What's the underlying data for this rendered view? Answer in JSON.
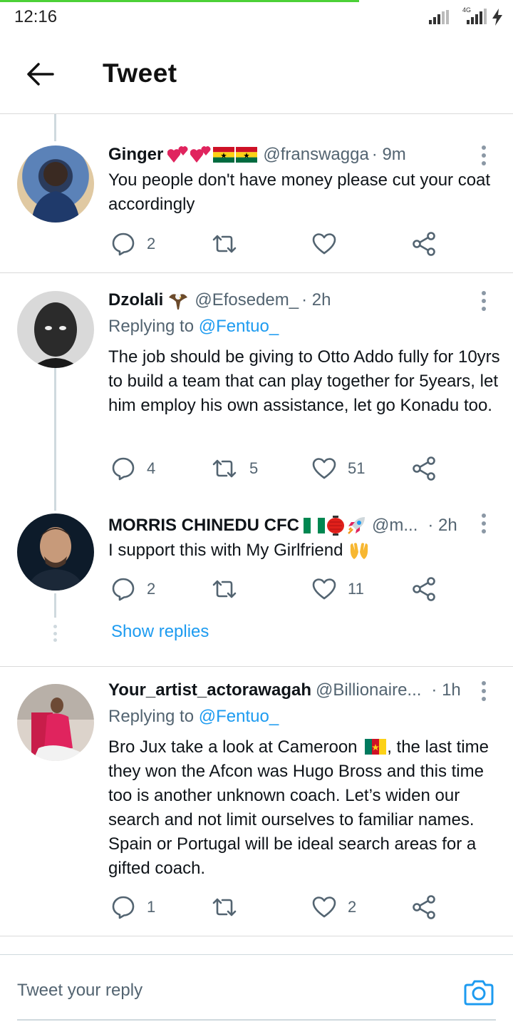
{
  "status_bar": {
    "time": "12:16",
    "network": "4G"
  },
  "header": {
    "title": "Tweet"
  },
  "tweets": [
    {
      "name": "Ginger",
      "emoji": [
        "two-hearts",
        "two-hearts",
        "ghana-flag",
        "ghana-flag"
      ],
      "handle": "@franswagga",
      "time": "· 9m",
      "text": "You people don't have money please cut your coat accordingly",
      "replies": "2",
      "retweets": "",
      "likes": ""
    },
    {
      "name": "Dzolali",
      "emoji": [
        "eagle"
      ],
      "handle": "@Efosedem_",
      "time": "· 2h",
      "replying_prefix": "Replying to",
      "replying_to": "@Fentuo_",
      "text": "The job should be giving to Otto Addo fully for 10yrs to build a team that can play together for 5years, let him employ his own assistance, let go Konadu too.",
      "replies": "4",
      "retweets": "5",
      "likes": "51"
    },
    {
      "name": "MORRIS CHINEDU CFC",
      "emoji": [
        "nigeria-flag",
        "red-lantern",
        "rocket"
      ],
      "handle": "@m...",
      "time": "· 2h",
      "text": "I support this with My Girlfriend",
      "text_emoji": "open-hands",
      "replies": "2",
      "retweets": "",
      "likes": "11"
    },
    {
      "name": "Your_artist_actorawagah",
      "emoji": [],
      "handle": "@Billionaire...",
      "time": "· 1h",
      "replying_prefix": "Replying to",
      "replying_to": "@Fentuo_",
      "text_before_flag": "Bro Jux take a look at Cameroon",
      "text_flag": "cameroon-flag",
      "text_after_flag": ", the last time they won the Afcon was Hugo Bross and this time too is another unknown coach. Let’s widen our search and not limit ourselves to familiar names. Spain or Portugal will be ideal search areas for a gifted coach.",
      "replies": "1",
      "retweets": "",
      "likes": "2"
    }
  ],
  "show_replies": "Show replies",
  "reply_bar": {
    "placeholder": "Tweet your reply"
  },
  "colors": {
    "accent": "#1d9bf0",
    "secondary_text": "#536471",
    "progress": "#4cd137"
  }
}
